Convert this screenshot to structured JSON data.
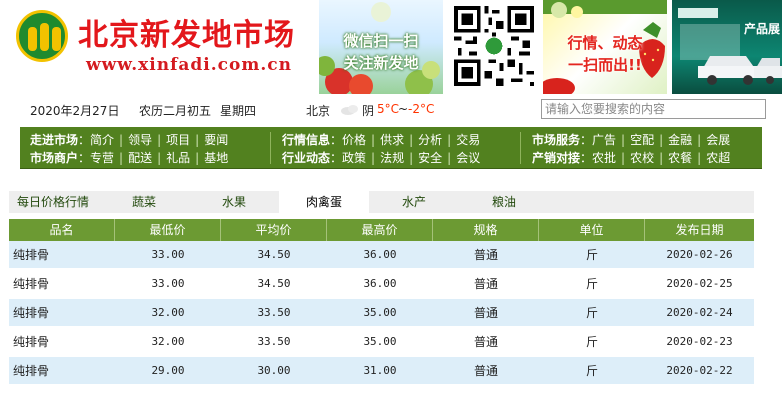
{
  "header": {
    "logo_name": "北京新发地市场",
    "logo_url": "www.xinfadi.com.cn",
    "banner_wechat_line1": "微信扫一扫",
    "banner_wechat_line2": "关注新发地",
    "banner_news_line1": "行情、动态",
    "banner_news_line2": "一扫而出!!",
    "banner_product_text": "产品展"
  },
  "infobar": {
    "date": "2020年2月27日",
    "lunar": "农历二月初五",
    "weekday": "星期四",
    "city": "北京",
    "weather": "阴",
    "temp_high": "5°C",
    "temp_sep": "~",
    "temp_low": "-2°C",
    "search_placeholder": "请输入您要搜索的内容"
  },
  "nav": {
    "block1": {
      "row1_title": "走进市场",
      "row1_links": [
        "简介",
        "领导",
        "项目",
        "要闻"
      ],
      "row2_title": "市场商户",
      "row2_links": [
        "专营",
        "配送",
        "礼品",
        "基地"
      ]
    },
    "block2": {
      "row1_title": "行情信息",
      "row1_links": [
        "价格",
        "供求",
        "分析",
        "交易"
      ],
      "row2_title": "行业动态",
      "row2_links": [
        "政策",
        "法规",
        "安全",
        "会议"
      ]
    },
    "block3": {
      "row1_title": "市场服务",
      "row1_links": [
        "广告",
        "空配",
        "金融",
        "会展"
      ],
      "row2_title": "产销对接",
      "row2_links": [
        "农批",
        "农校",
        "农餐",
        "农超"
      ]
    }
  },
  "tabs": [
    "每日价格行情",
    "蔬菜",
    "水果",
    "肉禽蛋",
    "水产",
    "粮油"
  ],
  "active_tab": "肉禽蛋",
  "table": {
    "headers": [
      "品名",
      "最低价",
      "平均价",
      "最高价",
      "规格",
      "单位",
      "发布日期"
    ],
    "rows": [
      [
        "纯排骨",
        "33.00",
        "34.50",
        "36.00",
        "普通",
        "斤",
        "2020-02-26"
      ],
      [
        "纯排骨",
        "33.00",
        "34.50",
        "36.00",
        "普通",
        "斤",
        "2020-02-25"
      ],
      [
        "纯排骨",
        "32.00",
        "33.50",
        "35.00",
        "普通",
        "斤",
        "2020-02-24"
      ],
      [
        "纯排骨",
        "32.00",
        "33.50",
        "35.00",
        "普通",
        "斤",
        "2020-02-23"
      ],
      [
        "纯排骨",
        "29.00",
        "30.00",
        "31.00",
        "普通",
        "斤",
        "2020-02-22"
      ]
    ]
  },
  "colors": {
    "logo_red": "#e3171b",
    "nav_green": "#52811f",
    "table_header_green": "#6c9a33",
    "row_blue": "#ddeef9",
    "temp_high": "#ff3300",
    "temp_low": "#ff3300"
  }
}
